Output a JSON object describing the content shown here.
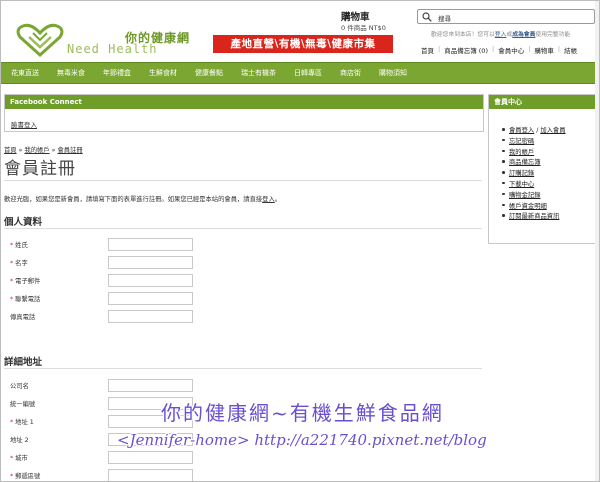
{
  "header": {
    "logo_cn": "你的健康網",
    "logo_en": "Need Health",
    "banner": "產地直營\\有機\\無毒\\健康市集",
    "cart_title": "購物車",
    "cart_sub": "0 件商品 NT$0",
    "search_value": "搜尋",
    "welcome_pre": "歡迎您來到本店！您可以",
    "welcome_login": "登入",
    "welcome_mid": "或",
    "welcome_join": "成為會員",
    "welcome_post": "使用完整功能",
    "toplinks": [
      "首頁",
      "商品備忘簿 (0)",
      "會員中心",
      "購物車",
      "結帳"
    ]
  },
  "nav": [
    "花東直送",
    "無毒米食",
    "年節禮盒",
    "生鮮食材",
    "健康餐點",
    "瑞士有機茶",
    "日韓專區",
    "商店街",
    "購物須知"
  ],
  "facebook": {
    "title": "Facebook Connect",
    "login": "臉書登入"
  },
  "sidebar": {
    "title": "會員中心",
    "items": [
      [
        "會員登入",
        " / ",
        "加入會員"
      ],
      [
        "忘記密碼"
      ],
      [
        "我的帳戶"
      ],
      [
        "商品備忘簿"
      ],
      [
        "訂購記錄"
      ],
      [
        "下載中心"
      ],
      [
        "購物金記錄"
      ],
      [
        "帳戶資金明細"
      ],
      [
        "訂閱最新商品資訊"
      ]
    ]
  },
  "breadcrumb": [
    "首頁",
    "我的帳戶",
    "會員註冊"
  ],
  "page_title": "會員註冊",
  "intro_pre": "歡迎光臨，如果您是新會員，請填寫下面的表單進行註冊。如果您已經是本站的會員，請直接",
  "intro_link": "登入",
  "intro_post": "。",
  "personal": {
    "title": "個人資料",
    "fields": [
      {
        "label": "姓氏",
        "required": true
      },
      {
        "label": "名字",
        "required": true
      },
      {
        "label": "電子郵件",
        "required": true
      },
      {
        "label": "聯繫電話",
        "required": true
      },
      {
        "label": "傳真電話",
        "required": false
      }
    ]
  },
  "address": {
    "title": "詳細地址",
    "fields": [
      {
        "label": "公司名",
        "required": false
      },
      {
        "label": "統一編號",
        "required": false
      },
      {
        "label": "地址 1",
        "required": true
      },
      {
        "label": "地址 2",
        "required": false
      },
      {
        "label": "城市",
        "required": true
      },
      {
        "label": "郵遞區號",
        "required": true
      }
    ]
  },
  "watermark": {
    "line1": "你的健康網~有機生鮮食品網",
    "line2": "<Jennifer-home> http://a221740.pixnet.net/blog"
  },
  "colors": {
    "nav_green": "#7aa631",
    "banner_red": "#d9251c",
    "watermark": "#6a4fd0"
  }
}
